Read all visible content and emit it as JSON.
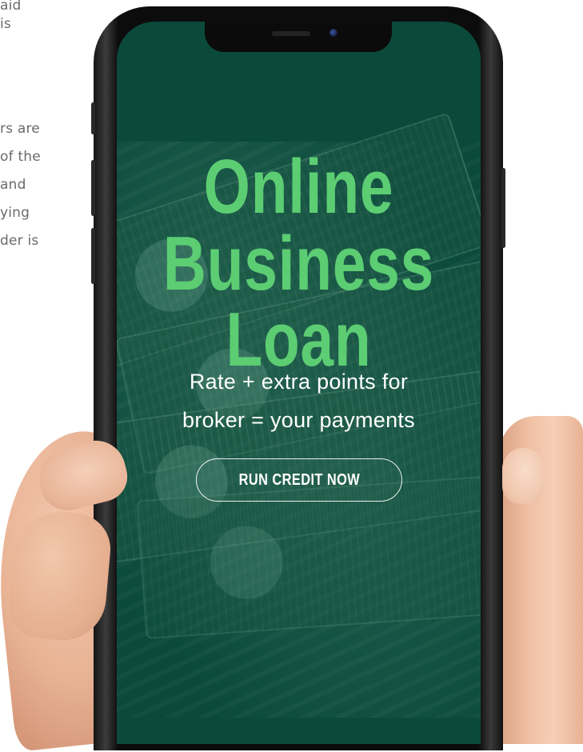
{
  "article": {
    "lines": [
      "aid",
      "is",
      "rs are",
      "of the",
      "and",
      "ying",
      "der is"
    ]
  },
  "phone": {
    "screen_bg": "#0b4a3b",
    "headline_color": "#5ccd73",
    "headline": {
      "line1": "Online",
      "line2": "Business",
      "line3": "Loan"
    },
    "subtext": {
      "line1": "Rate + extra points for",
      "line2": "broker = your payments"
    },
    "cta_label": "RUN CREDIT NOW"
  },
  "icons": {
    "camera": "camera-icon",
    "speaker": "speaker-grille-icon"
  }
}
